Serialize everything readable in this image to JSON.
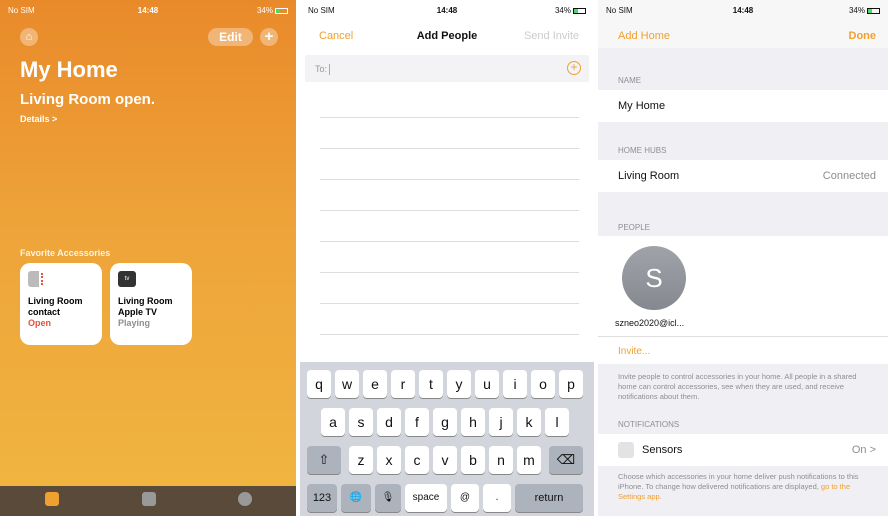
{
  "home_screen": {
    "status": {
      "carrier": "No SIM",
      "time": "14:48",
      "battery": "34%"
    },
    "edit_label": "Edit",
    "add_symbol": "+",
    "home_symbol": "⌂",
    "title": "My Home",
    "subtitle": "Living Room open.",
    "details_label": "Details >",
    "favorites_label": "Favorite Accessories",
    "accessories": [
      {
        "name_line1": "Living Room",
        "name_line2": "contact",
        "status": "Open",
        "icon": "contact-sensor-icon"
      },
      {
        "name_line1": "Living Room",
        "name_line2": "Apple TV",
        "status": "Playing",
        "icon": "apple-tv-icon"
      }
    ],
    "tabs": [
      "home-tab-icon",
      "rooms-tab-icon",
      "automation-tab-icon"
    ]
  },
  "add_people": {
    "status": {
      "carrier": "No SIM",
      "time": "14:48",
      "battery": "34%"
    },
    "cancel_label": "Cancel",
    "title": "Add People",
    "send_label": "Send Invite",
    "to_label": "To:",
    "keyboard": {
      "row1": [
        "q",
        "w",
        "e",
        "r",
        "t",
        "y",
        "u",
        "i",
        "o",
        "p"
      ],
      "row2": [
        "a",
        "s",
        "d",
        "f",
        "g",
        "h",
        "j",
        "k",
        "l"
      ],
      "row3": [
        "z",
        "x",
        "c",
        "v",
        "b",
        "n",
        "m"
      ],
      "shift": "⇧",
      "delete": "⌫",
      "numbers": "123",
      "globe": "🌐",
      "mic": "🎙",
      "space": "space",
      "at": "@",
      "dot": ".",
      "return": "return"
    }
  },
  "home_settings": {
    "status": {
      "carrier": "No SIM",
      "time": "14:48",
      "battery": "34%"
    },
    "back_label": "Add Home",
    "done_label": "Done",
    "name_header": "NAME",
    "home_name": "My Home",
    "hubs_header": "HOME HUBS",
    "hub_name": "Living Room",
    "hub_status": "Connected",
    "people_header": "PEOPLE",
    "person_initial": "S",
    "person_email": "szneo2020@icl...",
    "invite_label": "Invite...",
    "invite_footer": "Invite people to control accessories in your home. All people in a shared home can control accessories, see when they are used, and receive notifications about them.",
    "notifications_header": "NOTIFICATIONS",
    "sensors_label": "Sensors",
    "sensors_value": "On  >",
    "notif_footer": "Choose which accessories in your home deliver push notifications to this iPhone. To change how delivered notifications are displayed,",
    "notif_link": "go to the Settings app."
  },
  "colors": {
    "accent": "#f0a030",
    "open_red": "#e8503a",
    "secondary": "#8e8e93"
  }
}
